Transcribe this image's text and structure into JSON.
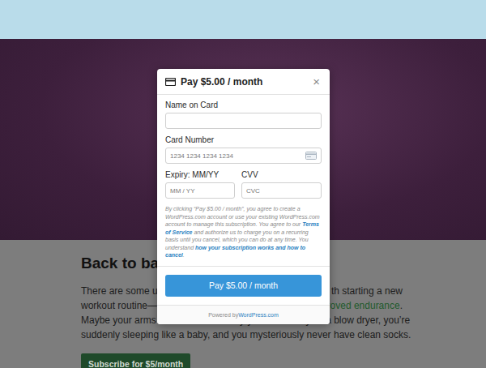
{
  "page": {
    "heading": "Back to basi",
    "paragraph_lines": [
      {
        "left": [
          {
            "text": "There are some une",
            "link": false
          }
        ],
        "right": [
          {
            "text": "th starting a new",
            "link": false
          }
        ]
      },
      {
        "left": [
          {
            "text": "workout routine—ar",
            "link": false
          }
        ],
        "right": [
          {
            "text": "proved endurance",
            "link": true
          },
          {
            "text": ".",
            "link": false
          }
        ]
      },
      {
        "left": [
          {
            "text": "Maybe your arms are so tired one day you can hardly lift a blow dryer, you’re",
            "link": false
          }
        ],
        "right": []
      },
      {
        "left": [
          {
            "text": "suddenly sleeping like a baby, and you mysteriously never have clean socks.",
            "link": false
          }
        ],
        "right": []
      }
    ],
    "subscribe_button": "Subscribe for $5/month"
  },
  "modal": {
    "title": "Pay $5.00 / month",
    "close": "×",
    "fields": [
      {
        "label": "Name on Card",
        "placeholder": "",
        "kind": "text"
      },
      {
        "label": "Card Number",
        "placeholder": "1234 1234 1234 1234",
        "kind": "card-number"
      },
      {
        "label": "Expiry: MM/YY",
        "placeholder": "MM / YY",
        "kind": "half"
      },
      {
        "label": "CVV",
        "placeholder": "CVC",
        "kind": "half"
      }
    ],
    "terms": [
      {
        "text": "By clicking “Pay $5.00 / month”, you agree to create a WordPress.com account or use your existing WordPress.com account to manage this subscription. You agree to our ",
        "link": false
      },
      {
        "text": "Terms of Service",
        "link": true
      },
      {
        "text": " and authorize us to charge you on a recurring basis until you cancel, which you can do at any time. You understand ",
        "link": false
      },
      {
        "text": "how your subscription works and how to cancel",
        "link": true
      },
      {
        "text": ".",
        "link": false
      }
    ],
    "pay_button": "Pay $5.00 / month",
    "footer": {
      "prefix": "Powered by ",
      "link": "WordPress.com"
    }
  }
}
